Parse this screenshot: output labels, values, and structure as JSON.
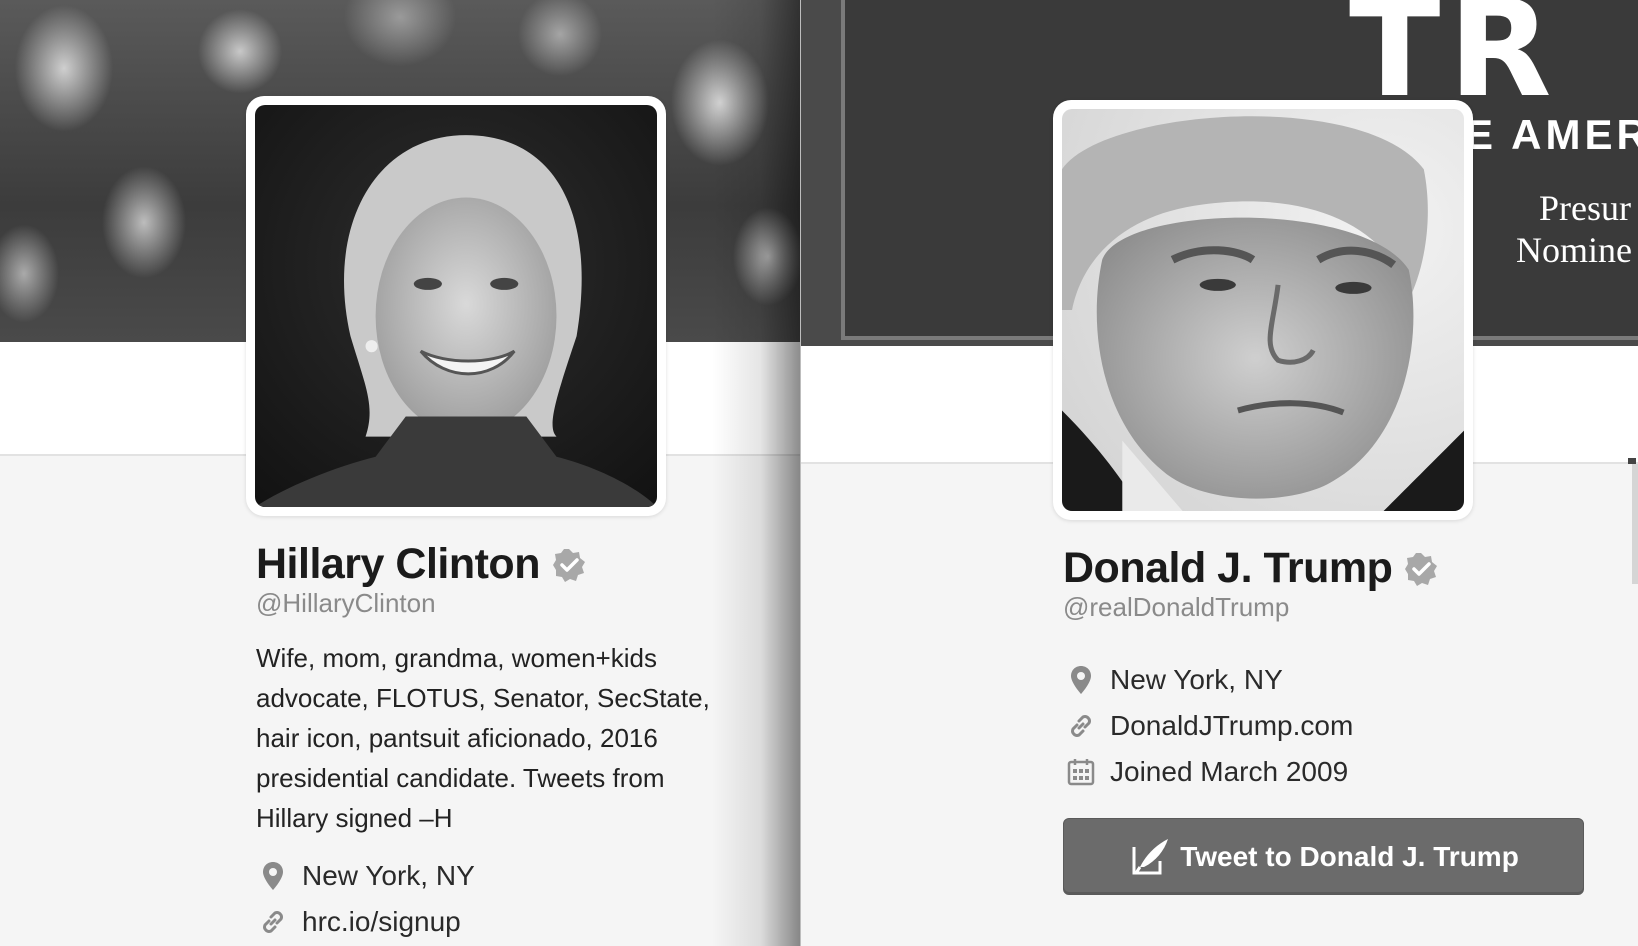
{
  "left_profile": {
    "name": "Hillary Clinton",
    "handle": "@HillaryClinton",
    "verified": true,
    "bio_lines": [
      "Wife, mom, grandma, women+kids",
      "advocate, FLOTUS, Senator, SecState,",
      "hair icon, pantsuit aficionado, 2016",
      "presidential candidate. Tweets from",
      "Hillary signed –H"
    ],
    "location": "New York, NY",
    "website": "hrc.io/signup",
    "icons": {
      "location": "map-pin-icon",
      "website": "link-icon",
      "verified": "verified-badge-icon"
    }
  },
  "right_profile": {
    "name": "Donald J. Trump",
    "handle": "@realDonaldTrump",
    "verified": true,
    "banner_text": {
      "big": "TR",
      "sub": "E AMER",
      "line1": "Presur",
      "line2": "Nomine"
    },
    "location": "New York, NY",
    "website": "DonaldJTrump.com",
    "joined": "Joined March 2009",
    "tweet_button_label": "Tweet to Donald J. Trump",
    "icons": {
      "location": "map-pin-icon",
      "website": "link-icon",
      "joined": "calendar-icon",
      "tweet": "compose-quill-icon",
      "verified": "verified-badge-icon"
    }
  },
  "colors": {
    "page_bg": "#f5f5f5",
    "text_primary": "#1b1b1b",
    "text_secondary": "#8a8a8a",
    "button_bg": "#6b6b6b",
    "verified_badge": "#a8a8a8"
  }
}
